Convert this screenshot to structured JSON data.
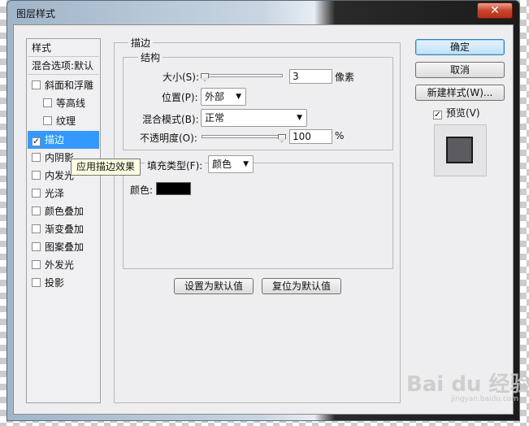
{
  "window": {
    "title": "图层样式",
    "close_glyph": "✕"
  },
  "style_list": {
    "header": "样式",
    "blend_options": "混合选项:默认",
    "items": [
      {
        "label": "斜面和浮雕",
        "checked": false
      },
      {
        "label": "等高线",
        "checked": false,
        "indent": true
      },
      {
        "label": "纹理",
        "checked": false,
        "indent": true
      },
      {
        "label": "描边",
        "checked": true,
        "selected": true
      },
      {
        "label": "内阴影",
        "checked": false
      },
      {
        "label": "内发光",
        "checked": false
      },
      {
        "label": "光泽",
        "checked": false
      },
      {
        "label": "颜色叠加",
        "checked": false
      },
      {
        "label": "渐变叠加",
        "checked": false
      },
      {
        "label": "图案叠加",
        "checked": false
      },
      {
        "label": "外发光",
        "checked": false
      },
      {
        "label": "投影",
        "checked": false
      }
    ]
  },
  "tooltip": "应用描边效果",
  "stroke": {
    "group_title": "描边",
    "structure_title": "结构",
    "size_label": "大小(S):",
    "size_value": "3",
    "size_unit": "像素",
    "position_label": "位置(P):",
    "position_value": "外部",
    "blend_mode_label": "混合模式(B):",
    "blend_mode_value": "正常",
    "opacity_label": "不透明度(O):",
    "opacity_value": "100",
    "opacity_unit": "%",
    "fill_type_label": "填充类型(F):",
    "fill_type_value": "颜色",
    "color_label": "颜色:",
    "color_hex": "#000000"
  },
  "buttons": {
    "ok": "确定",
    "cancel": "取消",
    "new_style": "新建样式(W)...",
    "preview_label": "预览(V)",
    "preview_checked": true,
    "make_default": "设置为默认值",
    "reset_default": "复位为默认值"
  },
  "watermark": {
    "main": "Bai du 经验",
    "sub": "jingyan.baidu.com"
  }
}
